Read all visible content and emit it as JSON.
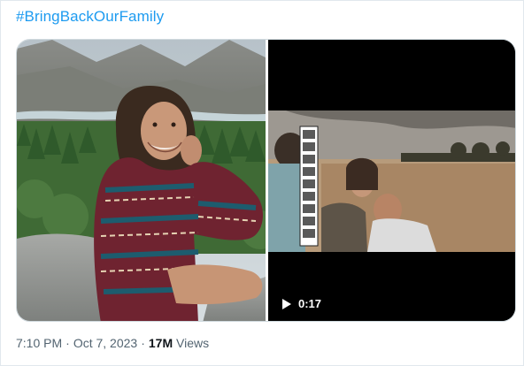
{
  "tweet": {
    "hashtag": "#BringBackOurFamily",
    "time": "7:10 PM",
    "separator": "·",
    "date": "Oct 7, 2023",
    "views_count": "17M",
    "views_label": "Views"
  },
  "media": {
    "photo": {
      "icon": "photo-woman-mountains"
    },
    "video": {
      "duration": "0:17",
      "play_icon": "play-icon"
    }
  },
  "colors": {
    "link": "#1d9bf0",
    "meta_text": "#536471",
    "strong_text": "#0f1419"
  }
}
